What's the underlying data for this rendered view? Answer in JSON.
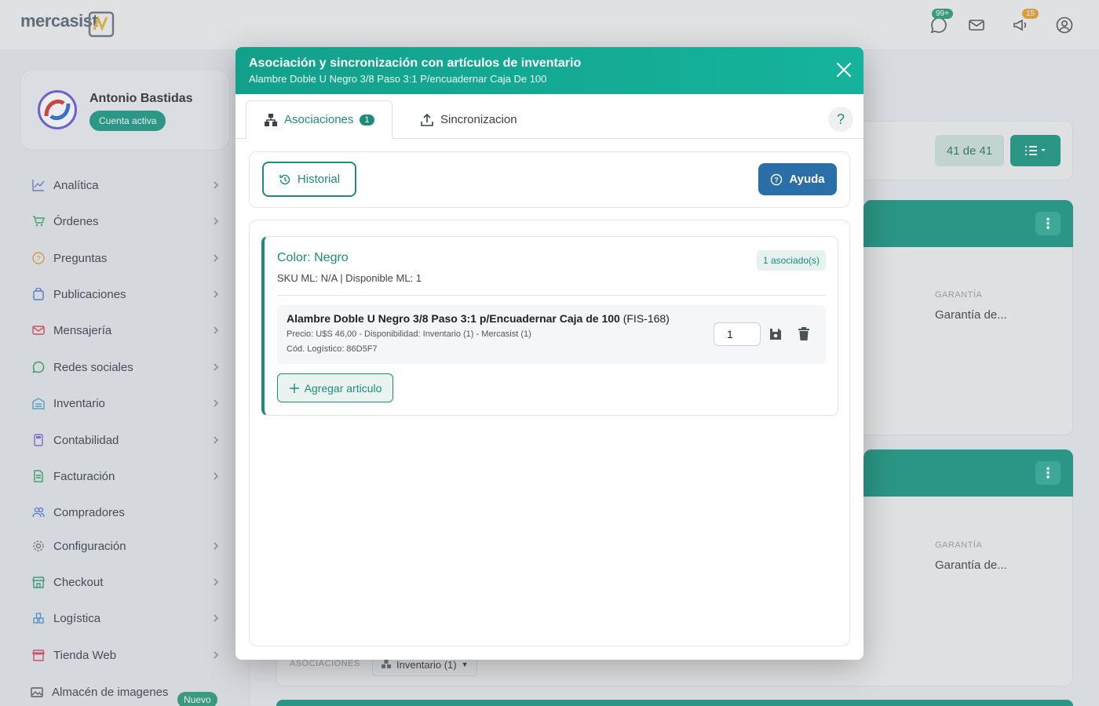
{
  "topbar": {
    "logo": "mercasist",
    "whatsapp_badge": "99+",
    "notifications_badge": "15"
  },
  "profile": {
    "name": "Antonio Bastidas",
    "status": "Cuenta activa"
  },
  "sidebar": {
    "items": [
      {
        "label": "Analítica",
        "icon": "chart-line-icon"
      },
      {
        "label": "Órdenes",
        "icon": "cart-icon"
      },
      {
        "label": "Preguntas",
        "icon": "question-circle-icon"
      },
      {
        "label": "Publicaciones",
        "icon": "bag-icon"
      },
      {
        "label": "Mensajería",
        "icon": "mail-icon"
      },
      {
        "label": "Redes sociales",
        "icon": "whatsapp-icon"
      },
      {
        "label": "Inventario",
        "icon": "warehouse-icon"
      },
      {
        "label": "Contabilidad",
        "icon": "calculator-icon"
      },
      {
        "label": "Facturación",
        "icon": "invoice-icon"
      },
      {
        "label": "Compradores",
        "icon": "users-icon"
      },
      {
        "label": "Configuración",
        "icon": "gear-icon"
      },
      {
        "label": "Checkout",
        "icon": "store-icon"
      },
      {
        "label": "Logística",
        "icon": "boxes-icon"
      },
      {
        "label": "Tienda Web",
        "icon": "shop-icon"
      },
      {
        "label": "Almacén de imagenes",
        "icon": "images-icon"
      }
    ],
    "new_badge": "Nuevo"
  },
  "background": {
    "count_label": "41 de 41",
    "garantia_label": "GARANTÍA",
    "garantia_value": "Garantía de...",
    "asociaciones_label": "ASOCIACIONES",
    "inventario_dropdown": "Inventario (1)"
  },
  "modal": {
    "title": "Asociación y sincronización con artículos de inventario",
    "subtitle": "Alambre Doble U Negro 3/8 Paso 3:1 P/encuadernar Caja De 100",
    "tabs": {
      "asociaciones": "Asociaciones",
      "asociaciones_count": "1",
      "sincronizacion": "Sincronizacion"
    },
    "help_symbol": "?",
    "historial_label": "Historial",
    "ayuda_label": "Ayuda",
    "variant": {
      "title": "Color: Negro",
      "meta": "SKU ML: N/A | Disponible ML: 1",
      "assoc_badge": "1 asociado(s)",
      "item": {
        "name": "Alambre Doble U Negro 3/8 Paso 3:1 p/Encuadernar Caja de 100",
        "code": "(FIS-168)",
        "price_line": "Precio: U$S 46,00 - Disponibilidad: Inventario (1) - Mercasist (1)",
        "logistic_line": "Cód. Logístico: 86D5F7",
        "quantity": "1"
      },
      "add_label": "Agregar articulo"
    }
  }
}
